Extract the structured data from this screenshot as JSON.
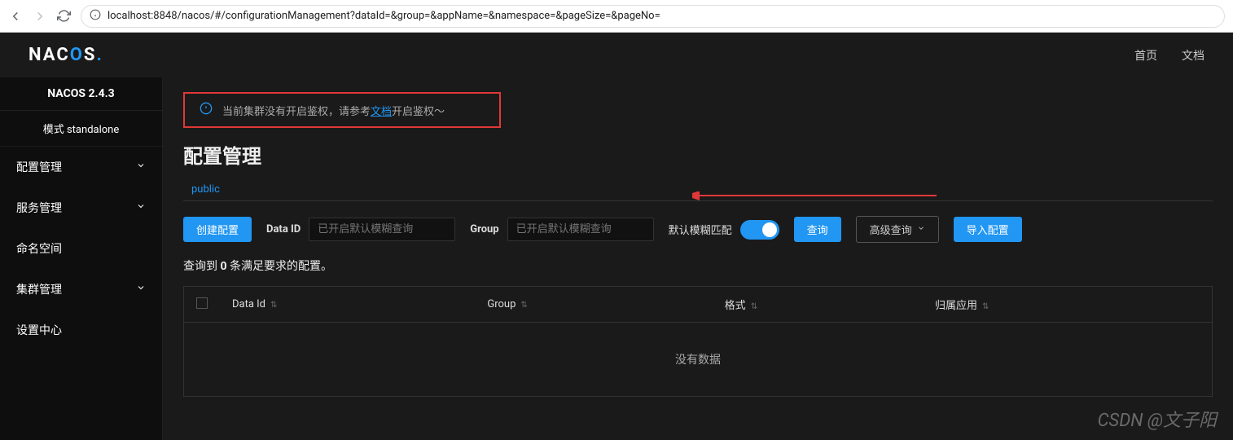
{
  "browser": {
    "url_host": "localhost",
    "url_path": ":8848/nacos/#/configurationManagement?dataId=&group=&appName=&namespace=&pageSize=&pageNo="
  },
  "header": {
    "logo_n": "N",
    "logo_a": "A",
    "logo_c": "C",
    "logo_o": "O",
    "logo_s": "S",
    "logo_dot": ".",
    "nav_home": "首页",
    "nav_doc": "文档"
  },
  "sidebar": {
    "version": "NACOS 2.4.3",
    "mode": "模式 standalone",
    "items": [
      {
        "label": "配置管理",
        "expandable": true
      },
      {
        "label": "服务管理",
        "expandable": true
      },
      {
        "label": "命名空间",
        "expandable": false
      },
      {
        "label": "集群管理",
        "expandable": true
      },
      {
        "label": "设置中心",
        "expandable": false
      }
    ]
  },
  "notice": {
    "before": "当前集群没有开启鉴权，请参考",
    "link": "文档",
    "after": "开启鉴权～"
  },
  "page": {
    "title": "配置管理",
    "namespace": "public"
  },
  "search": {
    "create_btn": "创建配置",
    "data_id_label": "Data ID",
    "data_id_placeholder": "已开启默认模糊查询",
    "group_label": "Group",
    "group_placeholder": "已开启默认模糊查询",
    "toggle_label": "默认模糊匹配",
    "query_btn": "查询",
    "advanced_btn": "高级查询",
    "import_btn": "导入配置"
  },
  "result": {
    "prefix": "查询到 ",
    "count": "0",
    "suffix": " 条满足要求的配置。"
  },
  "table": {
    "columns": [
      "Data Id",
      "Group",
      "格式",
      "归属应用"
    ],
    "empty": "没有数据"
  },
  "watermark": "CSDN @文子阳"
}
